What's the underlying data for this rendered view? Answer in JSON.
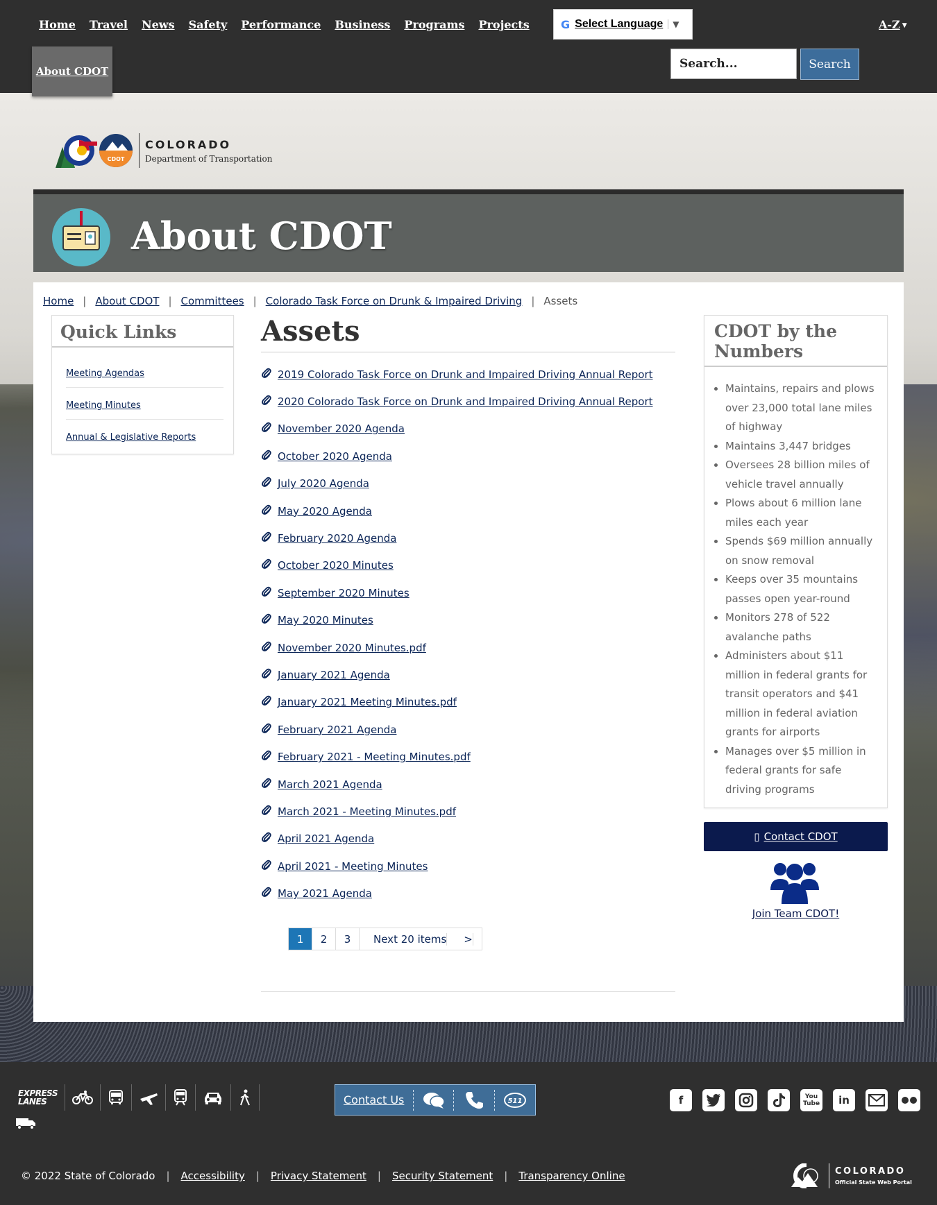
{
  "nav": {
    "items": [
      "Home",
      "Travel",
      "News",
      "Safety",
      "Performance",
      "Business",
      "Programs",
      "Projects"
    ],
    "active": "About CDOT",
    "language": "Select Language",
    "az": "A-Z",
    "search_placeholder": "Search...",
    "search_button": "Search"
  },
  "logo": {
    "line1": "COLORADO",
    "line2": "Department of Transportation",
    "badge": "CDOT"
  },
  "banner": {
    "title": "About CDOT"
  },
  "breadcrumb": {
    "items": [
      "Home",
      "About CDOT",
      "Committees",
      "Colorado Task Force on Drunk & Impaired Driving"
    ],
    "current": "Assets"
  },
  "quick_links": {
    "title": "Quick Links",
    "items": [
      "Meeting Agendas",
      "Meeting Minutes",
      "Annual & Legislative Reports"
    ]
  },
  "assets": {
    "title": "Assets",
    "items": [
      "2019 Colorado Task Force on Drunk and Impaired Driving Annual Report",
      "2020 Colorado Task Force on Drunk and Impaired Driving Annual Report",
      "November 2020 Agenda",
      "October 2020 Agenda",
      "July 2020 Agenda",
      "May 2020 Agenda",
      "February 2020 Agenda",
      "October 2020 Minutes",
      "September 2020 Minutes",
      "May 2020 Minutes",
      "November 2020 Minutes.pdf",
      "January 2021 Agenda",
      "January 2021 Meeting Minutes.pdf",
      "February 2021 Agenda",
      "February 2021 - Meeting Minutes.pdf",
      "March 2021 Agenda",
      "March 2021 - Meeting Minutes.pdf",
      "April 2021 Agenda",
      "April 2021 - Meeting Minutes",
      "May 2021 Agenda"
    ],
    "pager": {
      "pages": [
        "1",
        "2",
        "3"
      ],
      "current": "1",
      "next": "Next 20 items",
      "next_arrow": ">"
    }
  },
  "numbers": {
    "title": "CDOT by the Numbers",
    "items": [
      "Maintains, repairs and plows over 23,000 total lane miles of highway",
      "Maintains 3,447 bridges",
      "Oversees 28 billion miles of vehicle travel annually",
      "Plows about 6 million lane miles each year",
      "Spends $69 million annually on snow removal",
      "Keeps over 35 mountains passes open year-round",
      "Monitors 278 of 522 avalanche paths",
      "Administers about $11 million in federal grants for transit operators and $41 million in federal aviation grants for airports",
      "Manages over $5 million in federal grants for safe driving programs"
    ],
    "contact_button": "Contact CDOT",
    "team_link": "Join Team CDOT!"
  },
  "footer": {
    "express_lanes_line1": "EXPRESS",
    "express_lanes_line2": "LANES",
    "contact_us": "Contact Us",
    "contact_511": "511",
    "copyright": "© 2022 State of Colorado",
    "links": [
      "Accessibility",
      "Privacy Statement",
      "Security Statement",
      "Transparency Online"
    ],
    "portal_line1": "COLORADO",
    "portal_line2": "Official State Web Portal"
  },
  "colors": {
    "nav_bg": "#2f2f2f",
    "banner_bg": "#5d615f",
    "link": "#0b2557",
    "button_dark": "#0b1a4d",
    "search_btn": "#3d6d9b",
    "pager_active": "#1d76b6"
  }
}
